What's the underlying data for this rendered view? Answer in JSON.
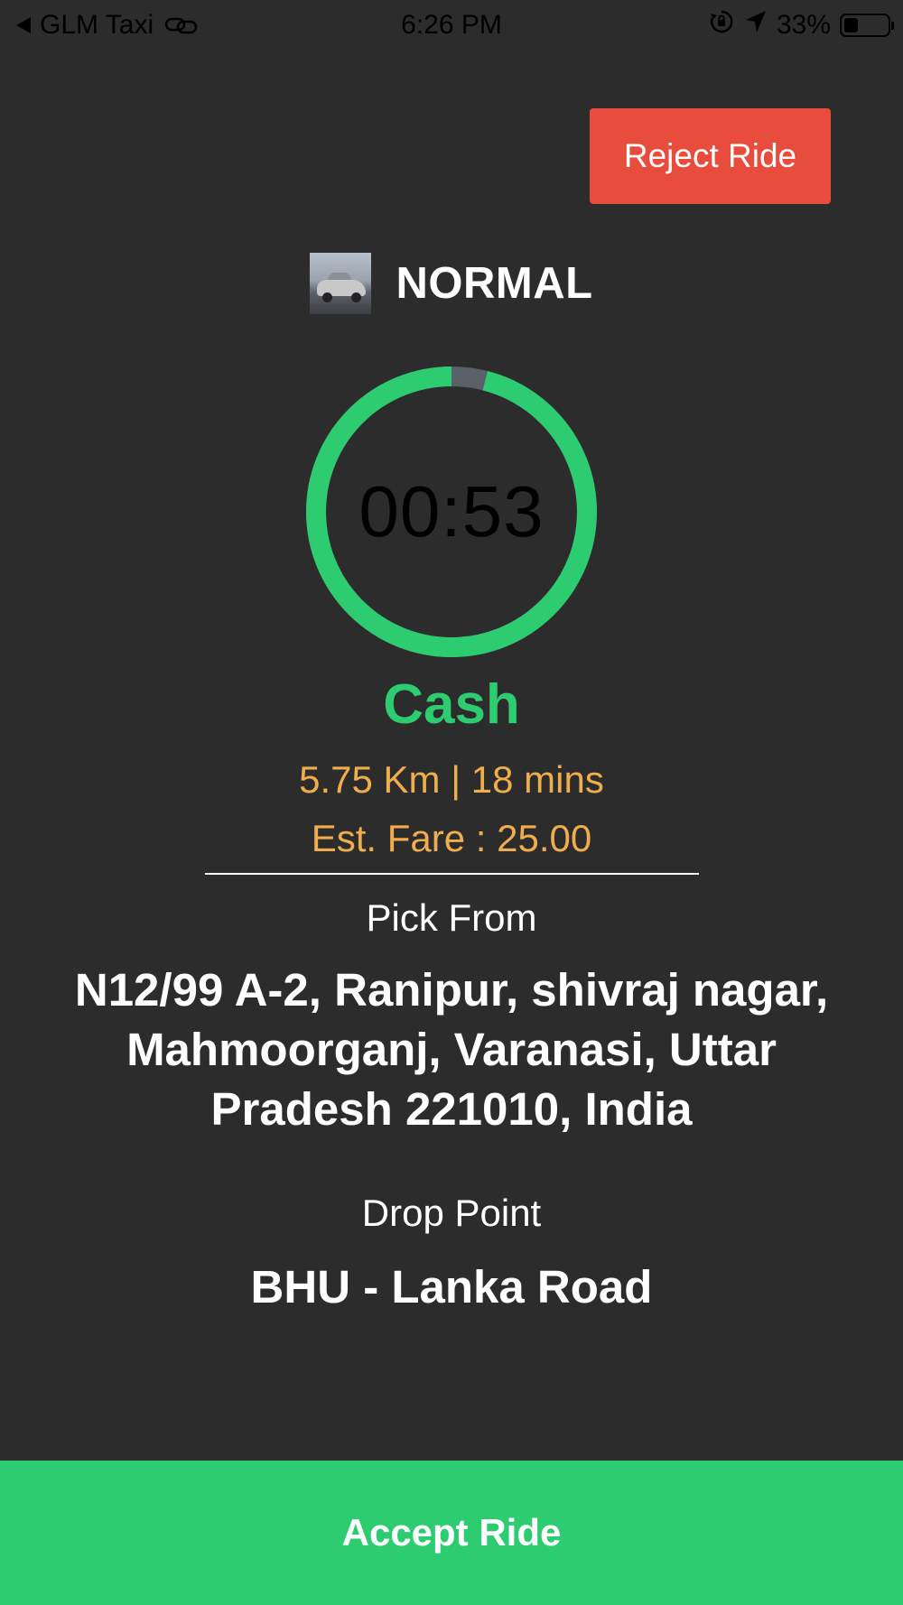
{
  "status_bar": {
    "back_app": "GLM Taxi",
    "time": "6:26 PM",
    "battery": "33%",
    "battery_level": 0.33,
    "icons": [
      "back-arrow-icon",
      "link-icon",
      "orientation-lock-icon",
      "location-arrow-icon",
      "battery-icon"
    ]
  },
  "ride_request": {
    "reject_label": "Reject Ride",
    "car_type": "NORMAL",
    "timer": "00:53",
    "timer_progress": 0.96,
    "payment": "Cash",
    "distance_time": "5.75 Km | 18 mins",
    "fare": "Est. Fare : 25.00",
    "pick_label": "Pick From",
    "pick_address": "N12/99 A-2, Ranipur, shivraj nagar, Mahmoorganj, Varanasi, Uttar Pradesh 221010, India",
    "drop_label": "Drop Point",
    "drop_address": "BHU - Lanka Road",
    "accept_label": "Accept Ride"
  },
  "colors": {
    "background": "#2c2c2c",
    "accept": "#2ecc71",
    "reject": "#e74c3c",
    "accent_orange": "#f0ad4e",
    "timer_track": "#5a6068"
  }
}
